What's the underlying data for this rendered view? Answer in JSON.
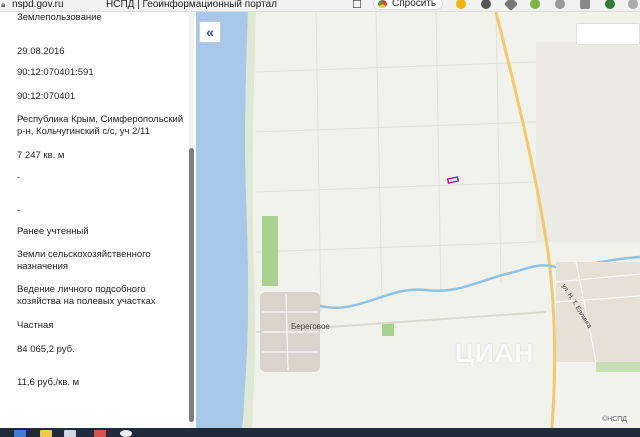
{
  "browser": {
    "url": "nspd.gov.ru",
    "tab_title": "НСПД | Геоинформационный портал",
    "ask_label": "Спросить"
  },
  "panel": {
    "rows": [
      "Землепользование",
      "29.08.2016",
      "90:12:070401:591",
      "90:12:070401",
      "Республика Крым, Симферопольский р-н, Кольчугинский с/с, уч 2/11",
      "7 247 кв. м",
      "-",
      "-",
      "Ранее учтенный",
      "Земли сельскохозяйственного назначения",
      "Ведение личного подсобного хозяйства на полевых участках",
      "Частная",
      "84 065,2 руб.",
      "11,6 руб./кв. м"
    ]
  },
  "map": {
    "collapse_icon": "«",
    "village_label": "Береговое",
    "road_label": "ул. Н. Т. Еллинга",
    "watermark": "ЦИАН",
    "copyright": "©НСПД",
    "colors": {
      "water": "#a7c8e8",
      "river": "#8fc3e6",
      "field": "#f2f2ed",
      "green": "#a9d18e",
      "road": "#f5c96a",
      "parcel": "#a020a0"
    }
  }
}
